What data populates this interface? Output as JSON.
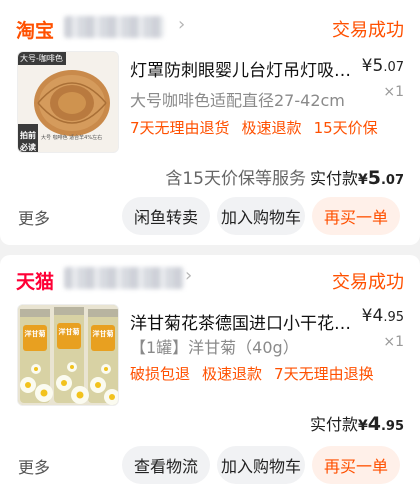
{
  "orders": [
    {
      "shop_platform": "淘宝",
      "platform_color": "#ff5000",
      "status": "交易成功",
      "product": {
        "title": "灯罩防刺眼婴儿台灯吊灯吸顶灯羊...",
        "spec": "大号咖啡色适配直径27-42cm",
        "price_symbol": "¥",
        "price_int": "5",
        "price_dec": ".07",
        "quantity": "×1",
        "thumb_tag_top": "大号-咖啡色",
        "thumb_tag_bottom_1": "拍前",
        "thumb_tag_bottom_2": "必读",
        "thumb_caption": "大号 咖啡色 适合羊4%左右"
      },
      "services": [
        "7天无理由退货",
        "极速退款",
        "15天价保"
      ],
      "summary_note": "含15天价保等服务",
      "paid_label": "实付款",
      "paid_symbol": "¥",
      "paid_int": "5",
      "paid_dec": ".07",
      "more_label": "更多",
      "buttons": [
        "闲鱼转卖",
        "加入购物车",
        "再买一单"
      ]
    },
    {
      "shop_platform": "天猫",
      "platform_color": "#ff0036",
      "status": "交易成功",
      "product": {
        "title": "洋甘菊花茶德国进口小干花散装花...",
        "spec": "【1罐】洋甘菊（40g）",
        "price_symbol": "¥",
        "price_int": "4",
        "price_dec": ".95",
        "quantity": "×1",
        "jar_label": "洋甘菊"
      },
      "services": [
        "破损包退",
        "极速退款",
        "7天无理由退换"
      ],
      "paid_label": "实付款",
      "paid_symbol": "¥",
      "paid_int": "4",
      "paid_dec": ".95",
      "more_label": "更多",
      "buttons": [
        "查看物流",
        "加入购物车",
        "再买一单"
      ]
    }
  ]
}
